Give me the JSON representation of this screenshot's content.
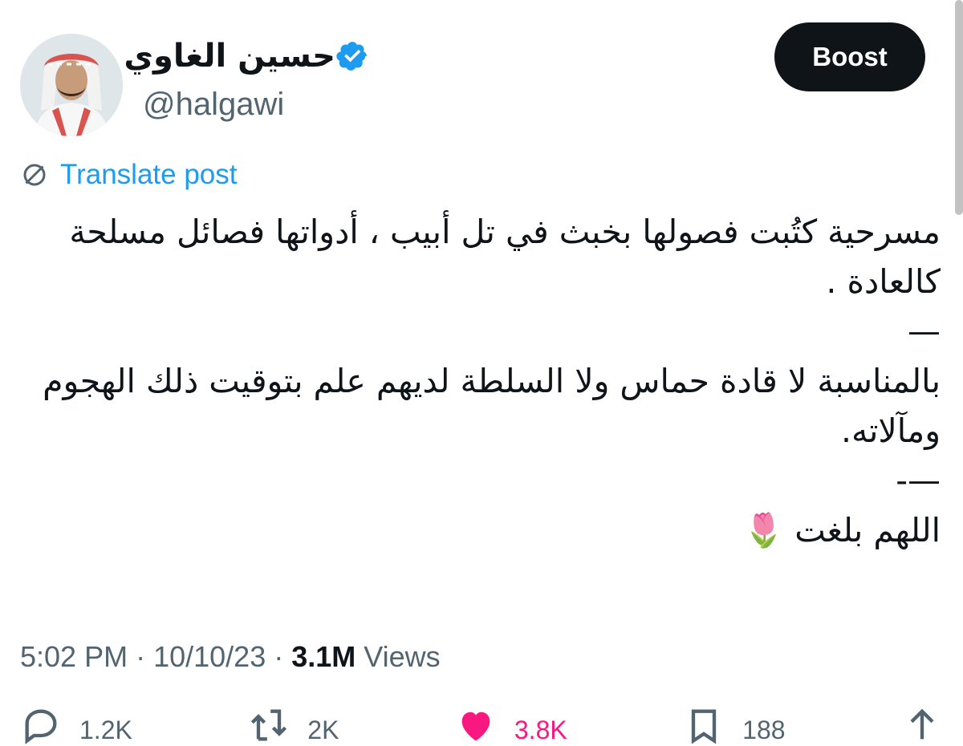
{
  "user": {
    "display_name": "حسين الغاوي",
    "handle": "@halgawi"
  },
  "header": {
    "boost_label": "Boost"
  },
  "translate": {
    "label": "Translate post"
  },
  "post": {
    "lines": [
      "مسرحية كتُبت فصولها بخبث في تل أبيب ، أدواتها فصائل مسلحة كالعادة .",
      "—",
      "بالمناسبة لا قادة حماس ولا السلطة لديهم علم بتوقيت ذلك الهجوم ومآلاته.",
      "—-",
      "اللهم بلغت 🌷"
    ]
  },
  "meta": {
    "time": "5:02 PM",
    "sep1": " · ",
    "date": "10/10/23",
    "sep2": " · ",
    "views_count": "3.1M",
    "views_label": " Views"
  },
  "actions": {
    "replies": "1.2K",
    "reposts": "2K",
    "likes": "3.8K",
    "bookmarks": "188"
  },
  "colors": {
    "accent": "#1d9bf0",
    "like": "#f91880",
    "text": "#0f1419",
    "secondary": "#536471"
  }
}
